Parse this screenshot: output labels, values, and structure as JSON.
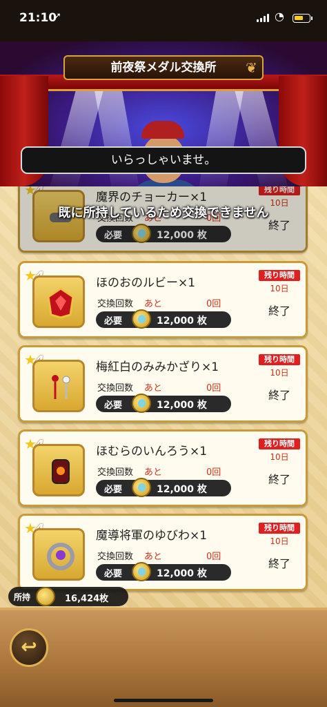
{
  "status_bar": {
    "time": "21:10",
    "location_icon": "location-arrow-icon"
  },
  "header": {
    "title": "前夜祭メダル交換所"
  },
  "npc": {
    "greeting": "いらっしゃいませ。"
  },
  "notice": {
    "already_owned": "既に所持しているため交換できません"
  },
  "items": [
    {
      "rarity": "★4",
      "name": "魔界のチョーカー×1",
      "exchange_label": "交換回数",
      "remaining_label": "あと",
      "remaining": "0回",
      "required_label": "必要",
      "cost": "12,000 枚",
      "time_label": "残り時間",
      "days": "10日",
      "status": "終了"
    },
    {
      "rarity": "★4",
      "name": "ほのおのルビー×1",
      "exchange_label": "交換回数",
      "remaining_label": "あと",
      "remaining": "0回",
      "required_label": "必要",
      "cost": "12,000 枚",
      "time_label": "残り時間",
      "days": "10日",
      "status": "終了"
    },
    {
      "rarity": "★4",
      "name": "梅紅白のみみかざり×1",
      "exchange_label": "交換回数",
      "remaining_label": "あと",
      "remaining": "0回",
      "required_label": "必要",
      "cost": "12,000 枚",
      "time_label": "残り時間",
      "days": "10日",
      "status": "終了"
    },
    {
      "rarity": "★4",
      "name": "ほむらのいんろう×1",
      "exchange_label": "交換回数",
      "remaining_label": "あと",
      "remaining": "0回",
      "required_label": "必要",
      "cost": "12,000 枚",
      "time_label": "残り時間",
      "days": "10日",
      "status": "終了"
    },
    {
      "rarity": "★4",
      "name": "魔導将軍のゆびわ×1",
      "exchange_label": "交換回数",
      "remaining_label": "あと",
      "remaining": "0回",
      "required_label": "必要",
      "cost": "12,000 枚",
      "time_label": "残り時間",
      "days": "10日",
      "status": "終了"
    }
  ],
  "holding": {
    "label": "所持",
    "amount": "16,424枚"
  },
  "footer": {
    "back_icon": "back-arrow-icon",
    "back_glyph": "↩"
  },
  "colors": {
    "accent_red": "#e02020",
    "frame_gold": "#c89a3a",
    "panel_bg": "#fffbee"
  }
}
